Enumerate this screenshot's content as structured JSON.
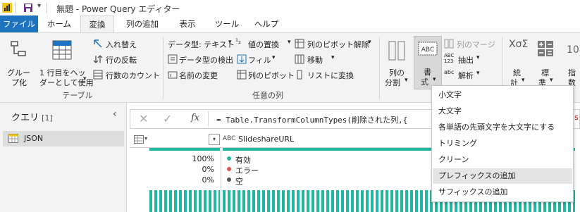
{
  "window": {
    "title": "無題 - Power Query エディター"
  },
  "tabs": [
    {
      "label": "ファイル"
    },
    {
      "label": "ホーム"
    },
    {
      "label": "変換"
    },
    {
      "label": "列の追加"
    },
    {
      "label": "表示"
    },
    {
      "label": "ツール"
    },
    {
      "label": "ヘルプ"
    }
  ],
  "ribbon": {
    "table_group": {
      "label": "テーブル",
      "group_by_l1": "グルー",
      "group_by_l2": "プ化",
      "first_row_l1": "1 行目をヘッ",
      "first_row_l2": "ダーとして使用",
      "transpose": "入れ替え",
      "reverse_rows": "行の反転",
      "count_rows": "行数のカウント"
    },
    "any_column_group": {
      "label": "任意の列",
      "data_type": "データ型: テキスト",
      "detect_type": "データ型の検出",
      "rename": "名前の変更",
      "replace_values": "値の置換",
      "fill": "フィル",
      "pivot_column": "列のピボット",
      "unpivot": "列のピボット解除",
      "move": "移動",
      "to_list": "リストに変換"
    },
    "text_group": {
      "split_l1": "列の",
      "split_l2": "分割",
      "format_l1": "書",
      "format_l2": "式",
      "merge_columns": "列のマージ",
      "extract": "抽出",
      "parse": "解析",
      "abc_label": "ABC",
      "abc123_l1": "ABC",
      "abc123_l2": "123"
    },
    "number_group": {
      "statistics_l1": "統",
      "statistics_l2": "計",
      "standard_l1": "標",
      "standard_l2": "準",
      "scientific_l1": "指",
      "scientific_l2": "数",
      "sci_number": "10"
    }
  },
  "queries": {
    "title": "クエリ",
    "count": "[1]",
    "items": [
      {
        "name": "JSON"
      }
    ]
  },
  "formula": {
    "fx": "fx",
    "text": "= Table.TransformColumnTypes(削除された列,{"
  },
  "grid": {
    "column": {
      "type_label": "ABC",
      "name": "SlideshareURL"
    },
    "quality": [
      {
        "pct": "100%",
        "label": "有効",
        "color": "#21b7a1"
      },
      {
        "pct": "0%",
        "label": "エラー",
        "color": "#e05050"
      },
      {
        "pct": "0%",
        "label": "空",
        "color": "#555555"
      }
    ]
  },
  "format_menu": {
    "items": [
      {
        "label": "小文字"
      },
      {
        "label": "大文字"
      },
      {
        "label": "各単語の先頭文字を大文字にする"
      },
      {
        "label": "トリミング"
      },
      {
        "label": "クリーン"
      },
      {
        "label": "プレフィックスの追加"
      },
      {
        "label": "サフィックスの追加"
      }
    ]
  }
}
